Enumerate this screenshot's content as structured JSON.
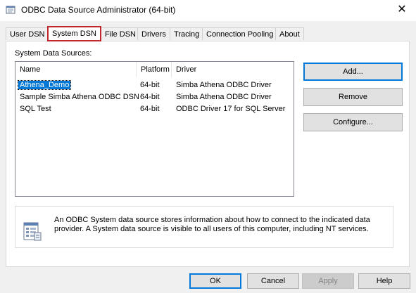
{
  "window": {
    "title": "ODBC Data Source Administrator (64-bit)",
    "close_glyph": "✕"
  },
  "tabs": [
    {
      "label": "User DSN"
    },
    {
      "label": "System DSN",
      "active": true
    },
    {
      "label": "File DSN"
    },
    {
      "label": "Drivers"
    },
    {
      "label": "Tracing"
    },
    {
      "label": "Connection Pooling"
    },
    {
      "label": "About"
    }
  ],
  "panel": {
    "section_label": "System Data Sources:",
    "columns": [
      "Name",
      "Platform",
      "Driver"
    ],
    "rows": [
      {
        "name": "Athena_Demo",
        "platform": "64-bit",
        "driver": "Simba Athena ODBC Driver",
        "selected": true
      },
      {
        "name": "Sample Simba Athena ODBC DSN",
        "platform": "64-bit",
        "driver": "Simba Athena ODBC Driver"
      },
      {
        "name": "SQL Test",
        "platform": "64-bit",
        "driver": "ODBC Driver 17 for SQL Server"
      }
    ],
    "buttons": {
      "add": "Add...",
      "remove": "Remove",
      "configure": "Configure..."
    },
    "info_text": "An ODBC System data source stores information about how to connect to the indicated data provider. A System data source is visible to all users of this computer, including NT services."
  },
  "footer": {
    "ok": "OK",
    "cancel": "Cancel",
    "apply": "Apply",
    "help": "Help"
  },
  "colors": {
    "selection": "#0078d7",
    "active_tab_border": "#c0282e"
  }
}
